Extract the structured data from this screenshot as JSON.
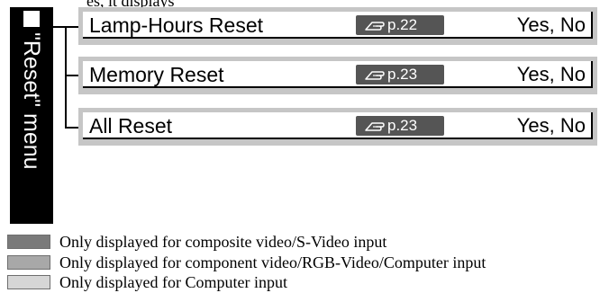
{
  "page": {
    "cut_text": "es, it displays"
  },
  "side_tab": {
    "label": "\"Reset\" menu"
  },
  "rows": [
    {
      "label": "Lamp-Hours Reset",
      "ref": "p.22",
      "value": "Yes, No"
    },
    {
      "label": "Memory Reset",
      "ref": "p.23",
      "value": "Yes, No"
    },
    {
      "label": "All Reset",
      "ref": "p.23",
      "value": "Yes, No"
    }
  ],
  "legend": [
    {
      "text": "Only displayed for composite video/S-Video input",
      "color": "#7a7a7a"
    },
    {
      "text": "Only displayed for component video/RGB-Video/Computer input",
      "color": "#a8a8a8"
    },
    {
      "text": "Only displayed for Computer input",
      "color": "#d6d6d6"
    }
  ],
  "colors": {
    "row_frame": "#c6c6c6",
    "ref_pill": "#555555",
    "side_tab": "#000000"
  },
  "icons": {
    "ref_icon": "pointing-hand-icon",
    "tab_marker": "square-icon"
  }
}
